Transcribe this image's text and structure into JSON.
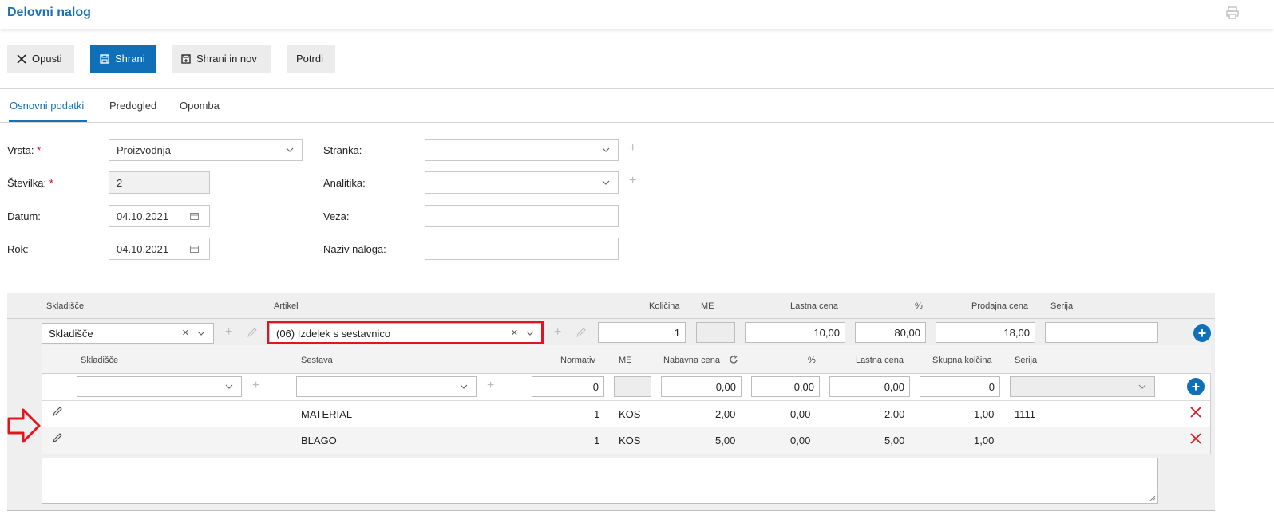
{
  "header": {
    "title": "Delovni nalog"
  },
  "toolbar": {
    "cancel_label": "Opusti",
    "save_label": "Shrani",
    "save_new_label": "Shrani in nov",
    "confirm_label": "Potrdi"
  },
  "tabs": [
    "Osnovni podatki",
    "Predogled",
    "Opomba"
  ],
  "form": {
    "vrsta_label": "Vrsta:",
    "vrsta_value": "Proizvodnja",
    "stevilka_label": "Številka:",
    "stevilka_value": "2",
    "datum_label": "Datum:",
    "datum_value": "04.10.2021",
    "rok_label": "Rok:",
    "rok_value": "04.10.2021",
    "required_mark": "*",
    "stranka_label": "Stranka:",
    "analitika_label": "Analitika:",
    "veza_label": "Veza:",
    "naziv_label": "Naziv naloga:"
  },
  "grid": {
    "headers": {
      "skladisce": "Skladišče",
      "artikel": "Artikel",
      "kolicina": "Količina",
      "me": "ME",
      "lastna_cena": "Lastna cena",
      "pct": "%",
      "prodajna_cena": "Prodajna cena",
      "serija": "Serija"
    },
    "entry": {
      "skladisce": "Skladišče",
      "artikel": "(06) Izdelek s sestavnico",
      "kolicina": "1",
      "lastna_cena": "10,00",
      "pct": "80,00",
      "prodajna_cena": "18,00"
    }
  },
  "subgrid": {
    "headers": {
      "skladisce": "Skladišče",
      "sestava": "Sestava",
      "normativ": "Normativ",
      "me": "ME",
      "nabavna_cena": "Nabavna cena",
      "pct": "%",
      "lastna_cena": "Lastna cena",
      "skupna_kolicina": "Skupna kolčina",
      "serija": "Serija"
    },
    "entry": {
      "normativ": "0",
      "nabavna_cena": "0,00",
      "pct": "0,00",
      "lastna_cena": "0,00",
      "skupna_kolicina": "0"
    },
    "rows": [
      {
        "sestava": "MATERIAL",
        "normativ": "1",
        "me": "KOS",
        "nabavna_cena": "2,00",
        "pct": "0,00",
        "lastna_cena": "2,00",
        "skupna_kolicina": "1,00",
        "serija": "1111"
      },
      {
        "sestava": "BLAGO",
        "normativ": "1",
        "me": "KOS",
        "nabavna_cena": "5,00",
        "pct": "0,00",
        "lastna_cena": "5,00",
        "skupna_kolicina": "1,00",
        "serija": ""
      }
    ]
  },
  "colors": {
    "accent": "#0f6fb8",
    "highlight": "#e3141d"
  },
  "icons": [
    "print-icon",
    "close-icon",
    "save-icon",
    "save-new-icon",
    "chevron-down-icon",
    "calendar-icon",
    "plus-icon",
    "pencil-icon",
    "refresh-icon",
    "add-circle-icon",
    "delete-icon",
    "arrow-right-icon"
  ]
}
